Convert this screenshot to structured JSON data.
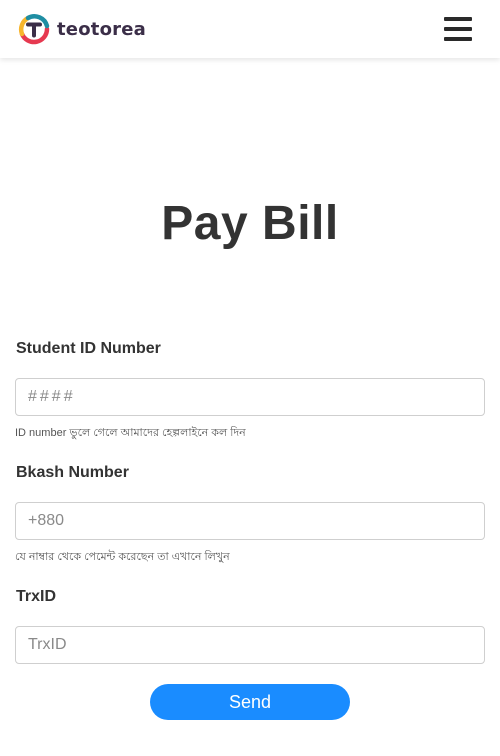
{
  "header": {
    "brand": "teotorea",
    "colors": {
      "brand_text": "#3b2e48",
      "logo_red": "#e63950",
      "logo_yellow": "#f7b52c",
      "logo_teal": "#1f8ea3",
      "logo_dark": "#3b2e48"
    },
    "menu_icon": "hamburger-menu-icon"
  },
  "main": {
    "title": "Pay Bill"
  },
  "form": {
    "student_id": {
      "label": "Student ID Number",
      "placeholder": "####",
      "help": "ID number ভুলে গেলে আমাদের হেল্পলাইনে কল দিন"
    },
    "bkash": {
      "label": "Bkash Number",
      "placeholder": "+880",
      "help": "যে নাম্বার থেকে পেমেন্ট করেছেন তা এখানে লিখুন"
    },
    "trxid": {
      "label": "TrxID",
      "placeholder": "TrxID"
    },
    "send_label": "Send",
    "accent_color": "#1a8cff"
  }
}
